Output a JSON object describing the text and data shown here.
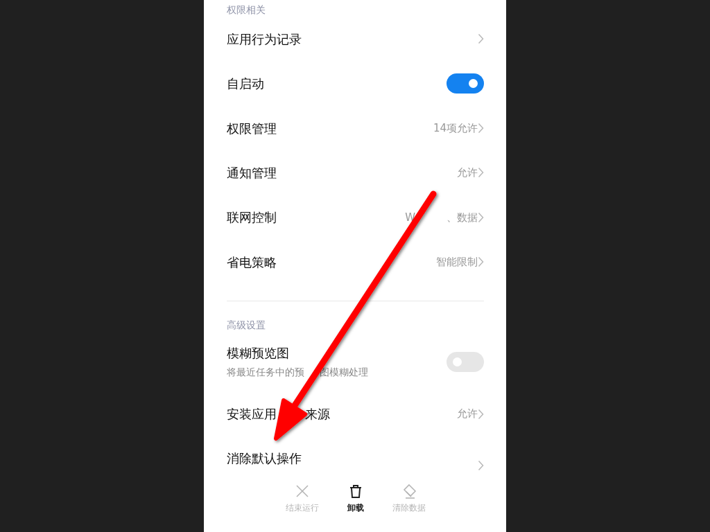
{
  "sections": [
    {
      "header": "权限相关",
      "items": [
        {
          "kind": "link",
          "title": "应用行为记录"
        },
        {
          "kind": "toggle",
          "title": "自启动",
          "on": true
        },
        {
          "kind": "link",
          "title": "权限管理",
          "value": "14项允许"
        },
        {
          "kind": "link",
          "title": "通知管理",
          "value": "允许"
        },
        {
          "kind": "link",
          "title": "联网控制",
          "value": [
            "W",
            "、数据"
          ]
        },
        {
          "kind": "link",
          "title": "省电策略",
          "value": "智能限制"
        }
      ]
    },
    {
      "header": "高级设置",
      "items": [
        {
          "kind": "toggle",
          "title": "模糊预览图",
          "subtitle": [
            "将最近任务中的预",
            "图模糊处理"
          ],
          "on": false
        },
        {
          "kind": "link",
          "title": [
            "安装应用",
            "来源"
          ],
          "value": "允许"
        },
        {
          "kind": "link",
          "title": "消除默认操作"
        }
      ]
    }
  ],
  "actions": [
    {
      "label": "结束运行",
      "disabled": true
    },
    {
      "label": "卸载",
      "disabled": false
    },
    {
      "label": "清除数据",
      "disabled": true
    }
  ]
}
